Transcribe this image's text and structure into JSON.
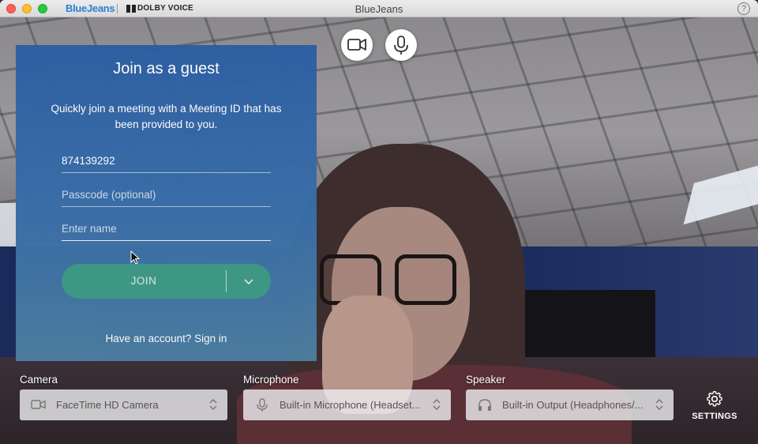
{
  "window": {
    "title": "BlueJeans",
    "brand_logo": "BlueJeans",
    "partner_logo": "DOLBY VOICE"
  },
  "icons": {
    "help": "question-circle-icon",
    "camera": "video-camera-icon",
    "microphone": "microphone-icon",
    "speaker": "headphones-icon",
    "settings": "gear-icon",
    "join_dropdown": "chevron-down-icon",
    "select_arrows": "updown-chevron-icon",
    "help_glyph": "?"
  },
  "guest_panel": {
    "title": "Join as a guest",
    "description": "Quickly join a meeting with a Meeting ID that has been provided to you.",
    "meeting_id_value": "874139292",
    "passcode_placeholder": "Passcode (optional)",
    "name_placeholder": "Enter name",
    "join_label": "JOIN",
    "signin_text": "Have an account? Sign in"
  },
  "devices": {
    "camera": {
      "label": "Camera",
      "value": "FaceTime HD Camera"
    },
    "microphone": {
      "label": "Microphone",
      "value": "Built-in Microphone (Headset..."
    },
    "speaker": {
      "label": "Speaker",
      "value": "Built-in Output (Headphones/..."
    },
    "settings_label": "SETTINGS"
  },
  "colors": {
    "panel_top": "#2b5ea3",
    "panel_bottom": "#4d7e9f",
    "join_button": "#3f9b86",
    "brand_blue": "#2e7fd6"
  }
}
